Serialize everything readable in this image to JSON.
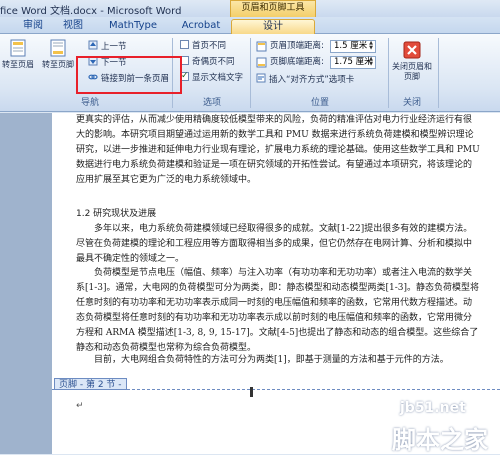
{
  "window": {
    "title": "fice Word 文档.docx - Microsoft Word",
    "context_tab_group": "页眉和页脚工具"
  },
  "tabs": [
    {
      "label": "审阅"
    },
    {
      "label": "视图"
    },
    {
      "label": "MathType"
    },
    {
      "label": "Acrobat"
    },
    {
      "label": "设计",
      "active": true
    }
  ],
  "ribbon": {
    "nav_group": {
      "goto_header": "转至页眉",
      "goto_footer": "转至页脚",
      "prev_section": "上一节",
      "next_section": "下一节",
      "link_previous": "链接到前一条页眉",
      "label": "导航"
    },
    "options_group": {
      "diff_first": "首页不同",
      "diff_odd_even": "奇偶页不同",
      "show_doc_text": "显示文档文字",
      "label": "选项"
    },
    "position_group": {
      "header_from_top_label": "页眉顶端距离:",
      "header_from_top_value": "1.5 厘米",
      "footer_from_bottom_label": "页脚底端距离:",
      "footer_from_bottom_value": "1.75 厘米",
      "insert_align_tab": "插入“对齐方式”选项卡",
      "label": "位置"
    },
    "close_group": {
      "close_button": "关闭页眉和页脚",
      "label": "关闭"
    }
  },
  "document": {
    "paragraphs": [
      "更真实的评估，从而减少使用精确度较低模型带来的风险，负荷的精准评估对电力行业经济运行有很大的影响。本研究项目期望通过运用新的数学工具和 PMU 数据来进行系统负荷建模和模型辨识理论研究，以进一步推进和延伸电力行业现有理论，扩展电力系统的理论基础。使用这些数学工具和 PMU 数据进行电力系统负荷建模和验证是一项在研究领域的开拓性尝试。有望通过本项研究，将该理论的应用扩展至其它更为广泛的电力系统领域中。",
      "1.2 研究现状及进展",
      "多年以来，电力系统负荷建模领域已经取得很多的成就。文献[1-22]提出很多有效的建模方法。尽管在负荷建模的理论和工程应用等方面取得相当多的成果，但它仍然存在电网计算、分析和模拟中最具不确定性的领域之一。",
      "负荷模型是节点电压（幅值、频率）与注入功率（有功功率和无功功率）或者注入电流的数学关系[1-3]。通常，大电网的负荷模型可分为两类，即：静态模型和动态模型两类[1-3]。静态负荷模型将任意时刻的有功功率和无功功率表示成同一时刻的电压幅值和频率的函数，它常用代数方程描述。动态负荷模型将任意时刻的有功功率和无功功率表示成以前时刻的电压幅值和频率的函数，它常用微分方程和 ARMA 模型描述[1-3, 8, 9, 15-17]。文献[4-5]也提出了静态和动态的组合模型。这些综合了静态和动态负荷模型也常称为综合负荷模型。",
      "目前，大电网组合负荷特性的方法可分为两类[1]，即基于测量的方法和基于元件的方法。"
    ],
    "footer_label": "页脚 - 第 2 节 -"
  },
  "watermark": {
    "line1": "jb51.net",
    "line2": "脚本之家"
  }
}
